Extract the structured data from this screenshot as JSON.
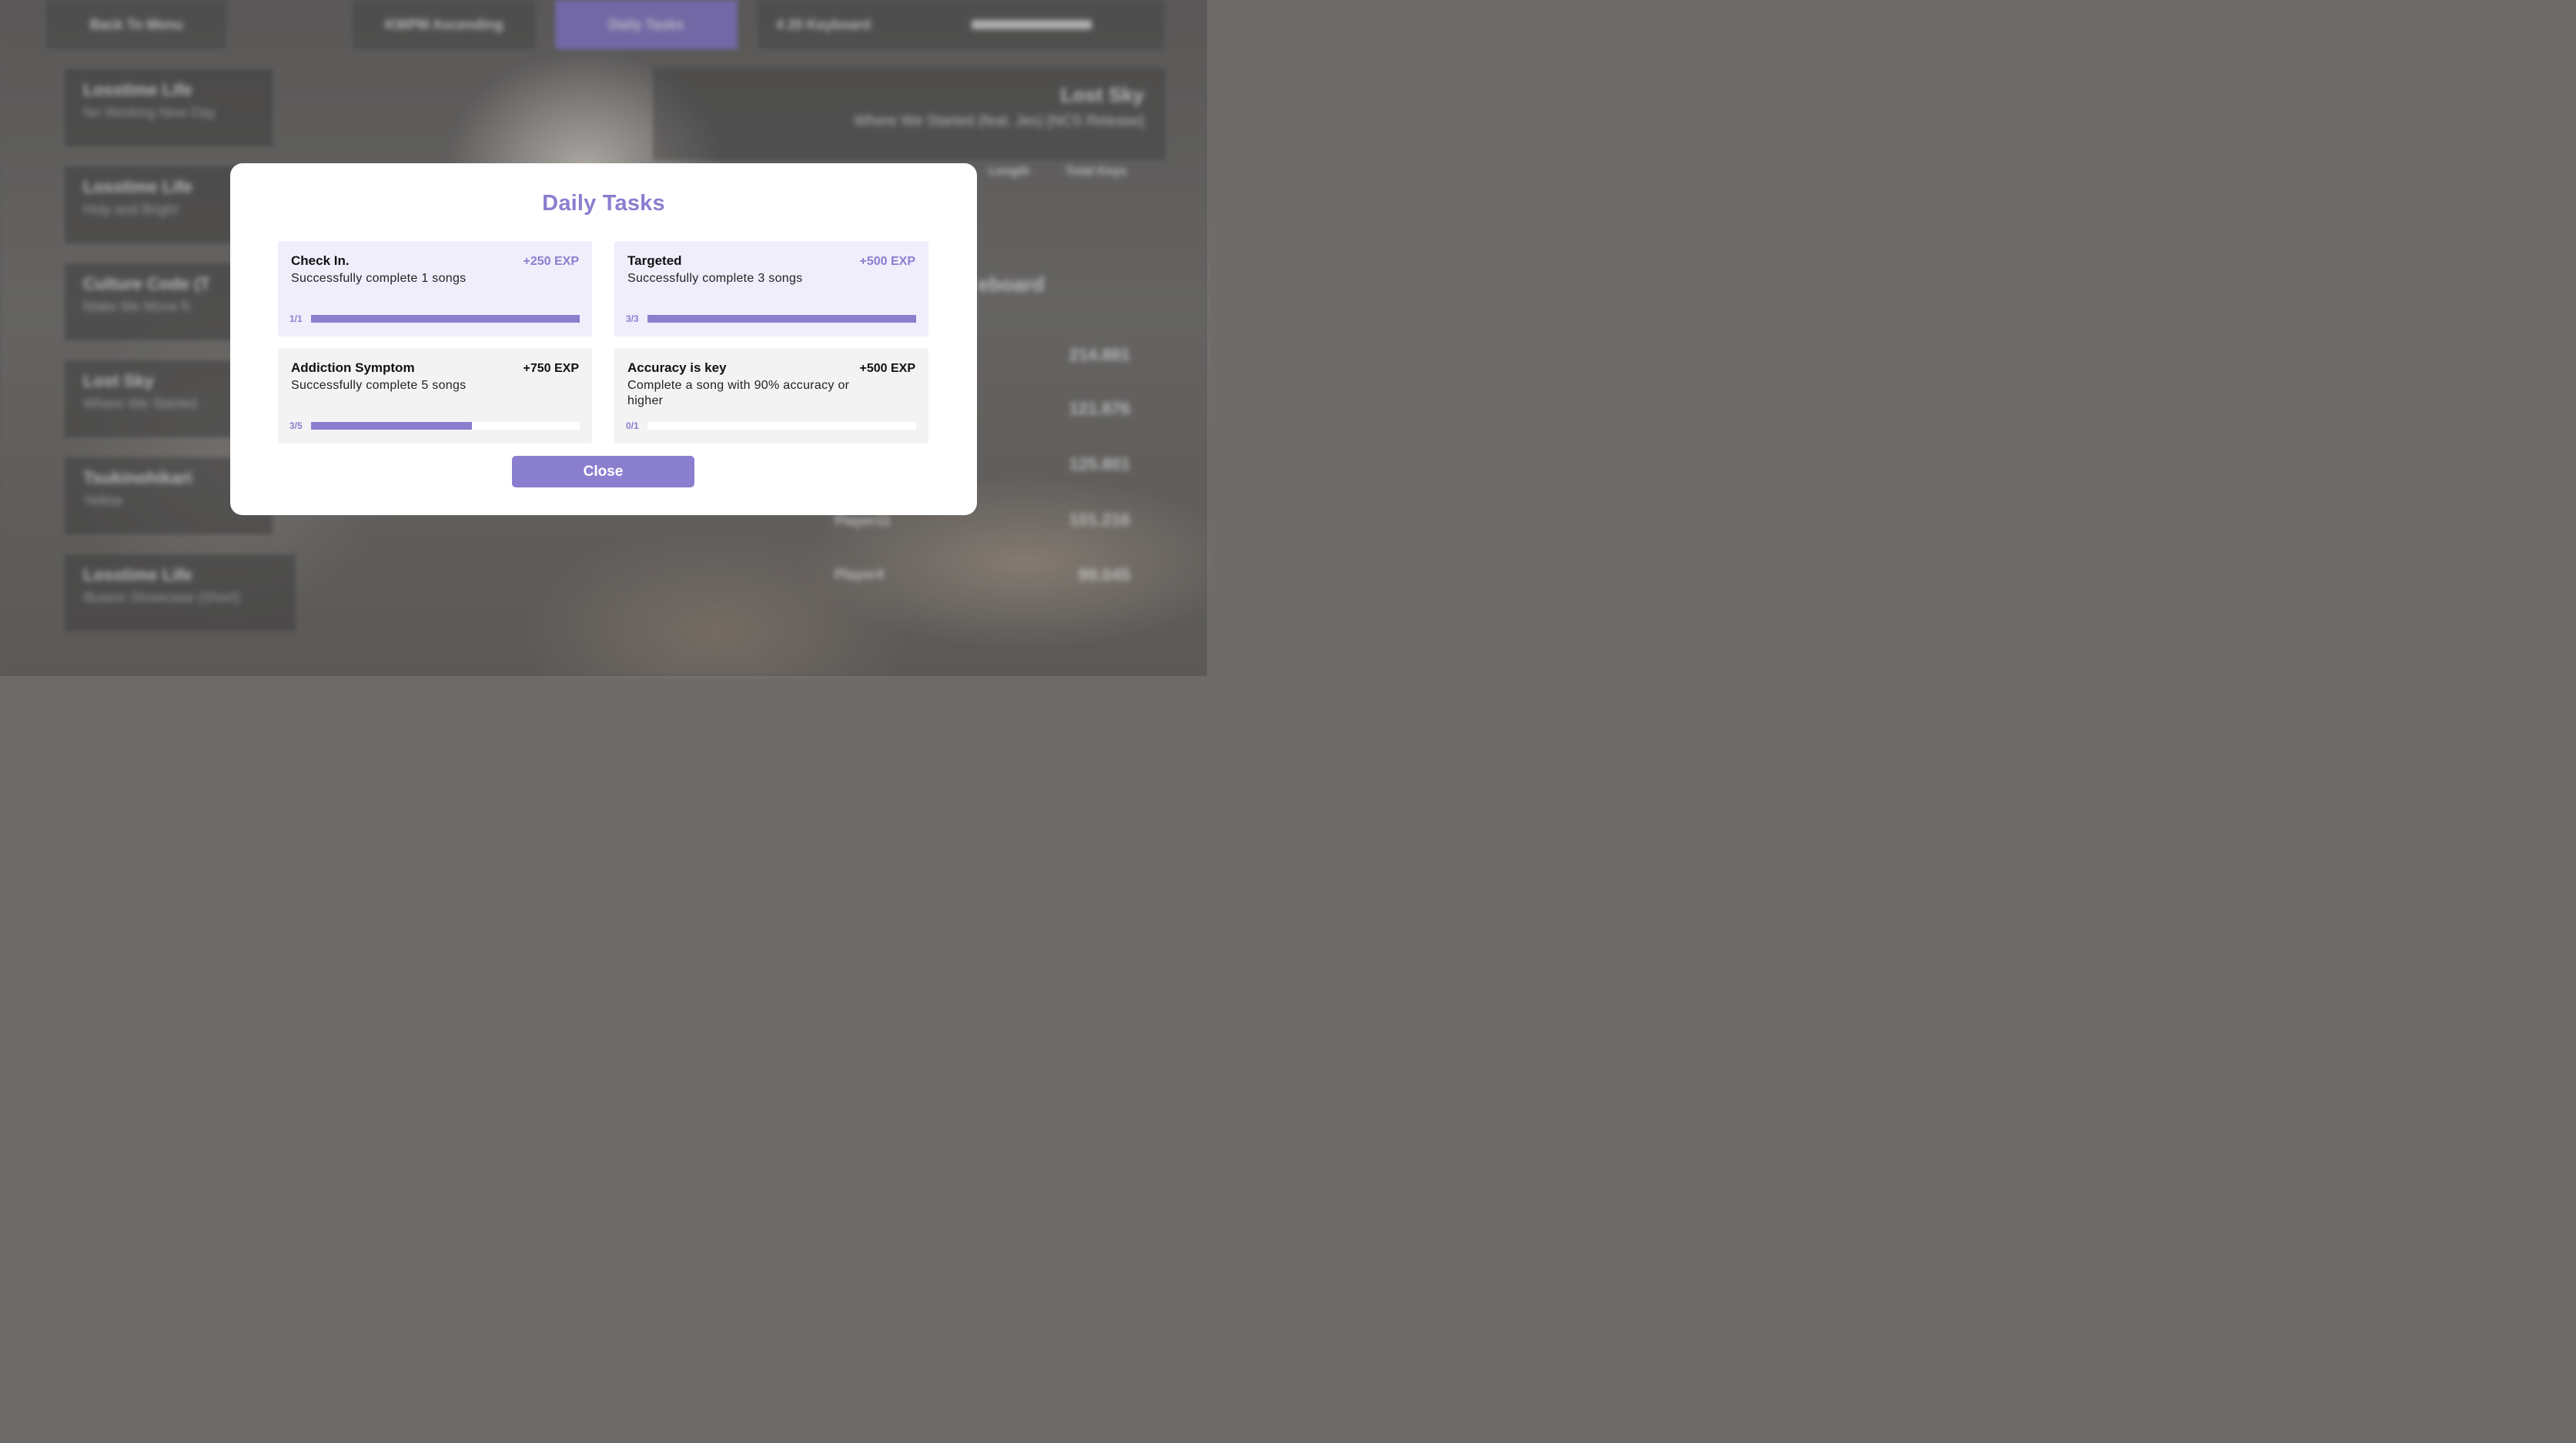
{
  "background": {
    "tabs": [
      "Back To Menu",
      "KWPM Ascending",
      "Daily Tasks",
      "4 20  Keyboard"
    ],
    "songs": [
      {
        "title": "Losstime Life",
        "subtitle": "No Working New Day"
      },
      {
        "title": "Losstime Life",
        "subtitle": "Holy and Bright"
      },
      {
        "title": "Culture Code (T",
        "subtitle": "Make Me Move ft."
      },
      {
        "title": "Lost Sky",
        "subtitle": "Where We Started"
      },
      {
        "title": "Tsukinohikari",
        "subtitle": "Yellow"
      },
      {
        "title": "Losstime Life",
        "subtitle": "Illusion Showcase (Short)"
      }
    ],
    "featured": {
      "title": "Lost Sky",
      "subtitle": "Where We Started (feat. Jex) [NCS Release]",
      "length_label": "Length",
      "keys_label": "Total Keys"
    },
    "leaderboard_label": "eboard",
    "scores": [
      "214.881",
      "121.876",
      "125.801",
      "101.216",
      "99.045"
    ],
    "players": [
      "Player11",
      "Player4"
    ]
  },
  "modal": {
    "title": "Daily Tasks",
    "close_label": "Close",
    "tasks": [
      {
        "name": "Check In.",
        "exp": "+250 EXP",
        "desc": "Successfully complete 1 songs",
        "progress_label": "1/1",
        "progress": 1.0,
        "completed": true
      },
      {
        "name": "Targeted",
        "exp": "+500 EXP",
        "desc": "Successfully complete 3 songs",
        "progress_label": "3/3",
        "progress": 1.0,
        "completed": true
      },
      {
        "name": "Addiction Symptom",
        "exp": "+750 EXP",
        "desc": "Successfully complete 5 songs",
        "progress_label": "3/5",
        "progress": 0.6,
        "completed": false
      },
      {
        "name": "Accuracy is key",
        "exp": "+500 EXP",
        "desc": "Complete a song with 90% accuracy or higher",
        "progress_label": "0/1",
        "progress": 0.0,
        "completed": false
      }
    ]
  },
  "colors": {
    "accent": "#8a7ecf",
    "done_card": "#f0eefb",
    "todo_card": "#f3f3f3"
  }
}
